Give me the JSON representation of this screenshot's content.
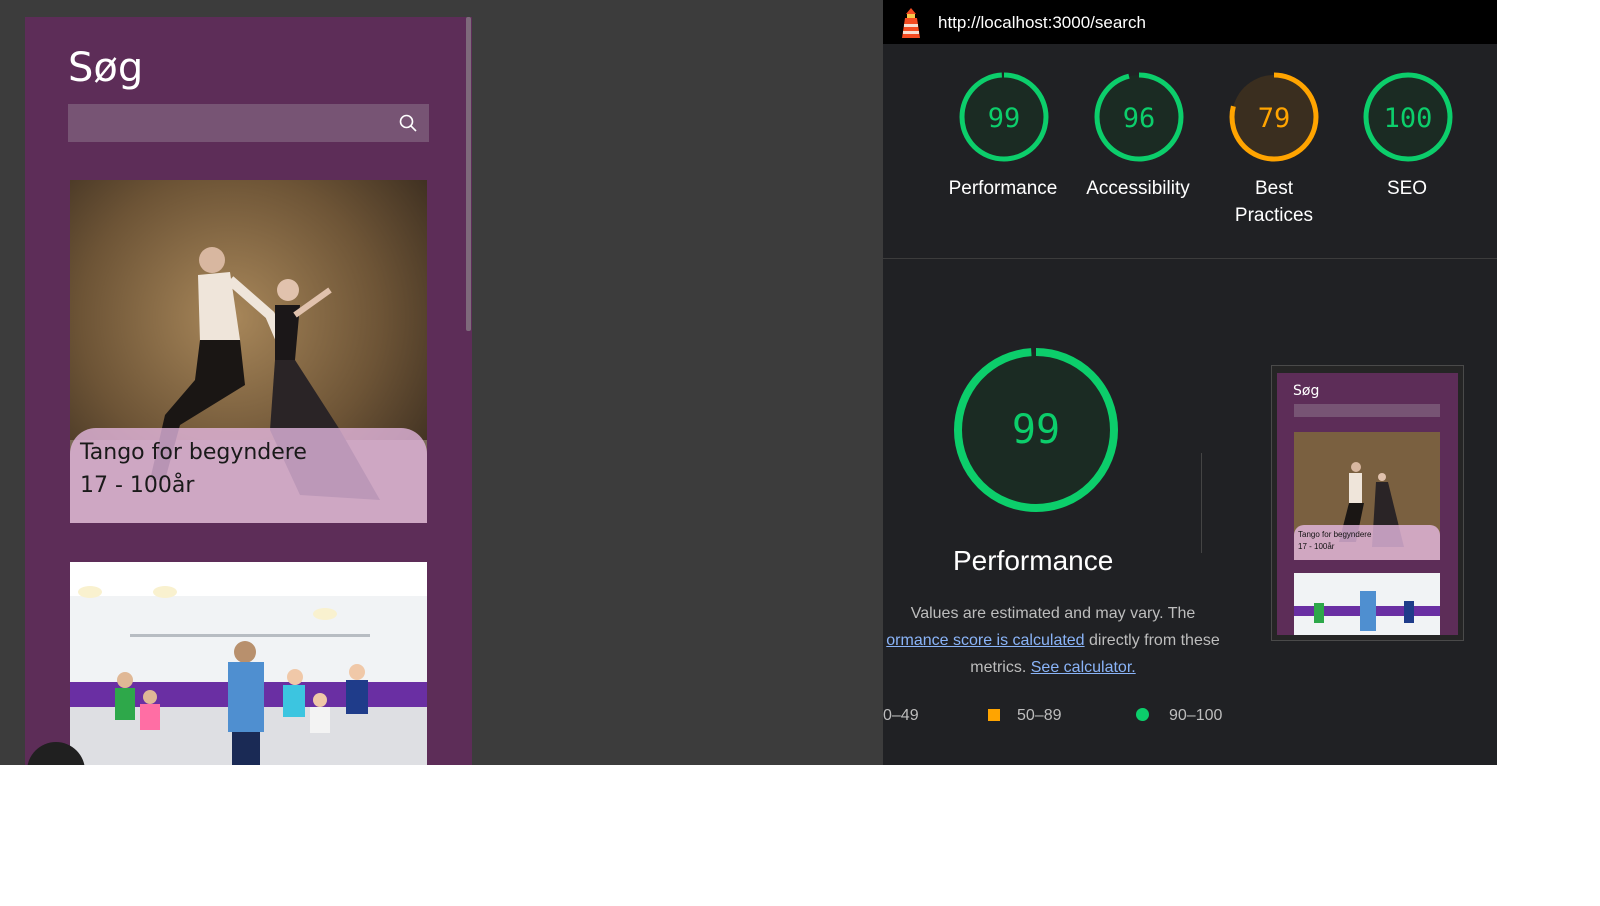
{
  "app": {
    "title": "Søg",
    "search": {
      "placeholder": "",
      "value": ""
    },
    "cards": [
      {
        "title": "Tango for begyndere",
        "ages": "17 - 100år"
      },
      {
        "title": "",
        "ages": ""
      }
    ]
  },
  "lighthouse": {
    "url": "http://localhost:3000/search",
    "scores": [
      {
        "label": "Performance",
        "value": "99",
        "color": "#0cce6b",
        "fraction": 0.99
      },
      {
        "label": "Accessibility",
        "value": "96",
        "color": "#0cce6b",
        "fraction": 0.96
      },
      {
        "label": "Best Practices",
        "value": "79",
        "color": "#ffa400",
        "fraction": 0.79
      },
      {
        "label": "SEO",
        "value": "100",
        "color": "#0cce6b",
        "fraction": 1.0
      }
    ],
    "detail": {
      "score": "99",
      "fraction": 0.99,
      "title": "Performance",
      "desc_1": "Values are estimated and may vary. The",
      "desc_link_1": "ormance score is calculated",
      "desc_2": " directly from these",
      "desc_3": "metrics.",
      "desc_link_2": "See calculator."
    },
    "legend": [
      {
        "range": "0–49",
        "color": "#ff4e42"
      },
      {
        "range": "50–89",
        "color": "#ffa400"
      },
      {
        "range": "90–100",
        "color": "#0cce6b"
      }
    ],
    "thumbnail": {
      "title": "Søg",
      "card_title": "Tango for begyndere",
      "card_ages": "17 - 100år"
    }
  }
}
